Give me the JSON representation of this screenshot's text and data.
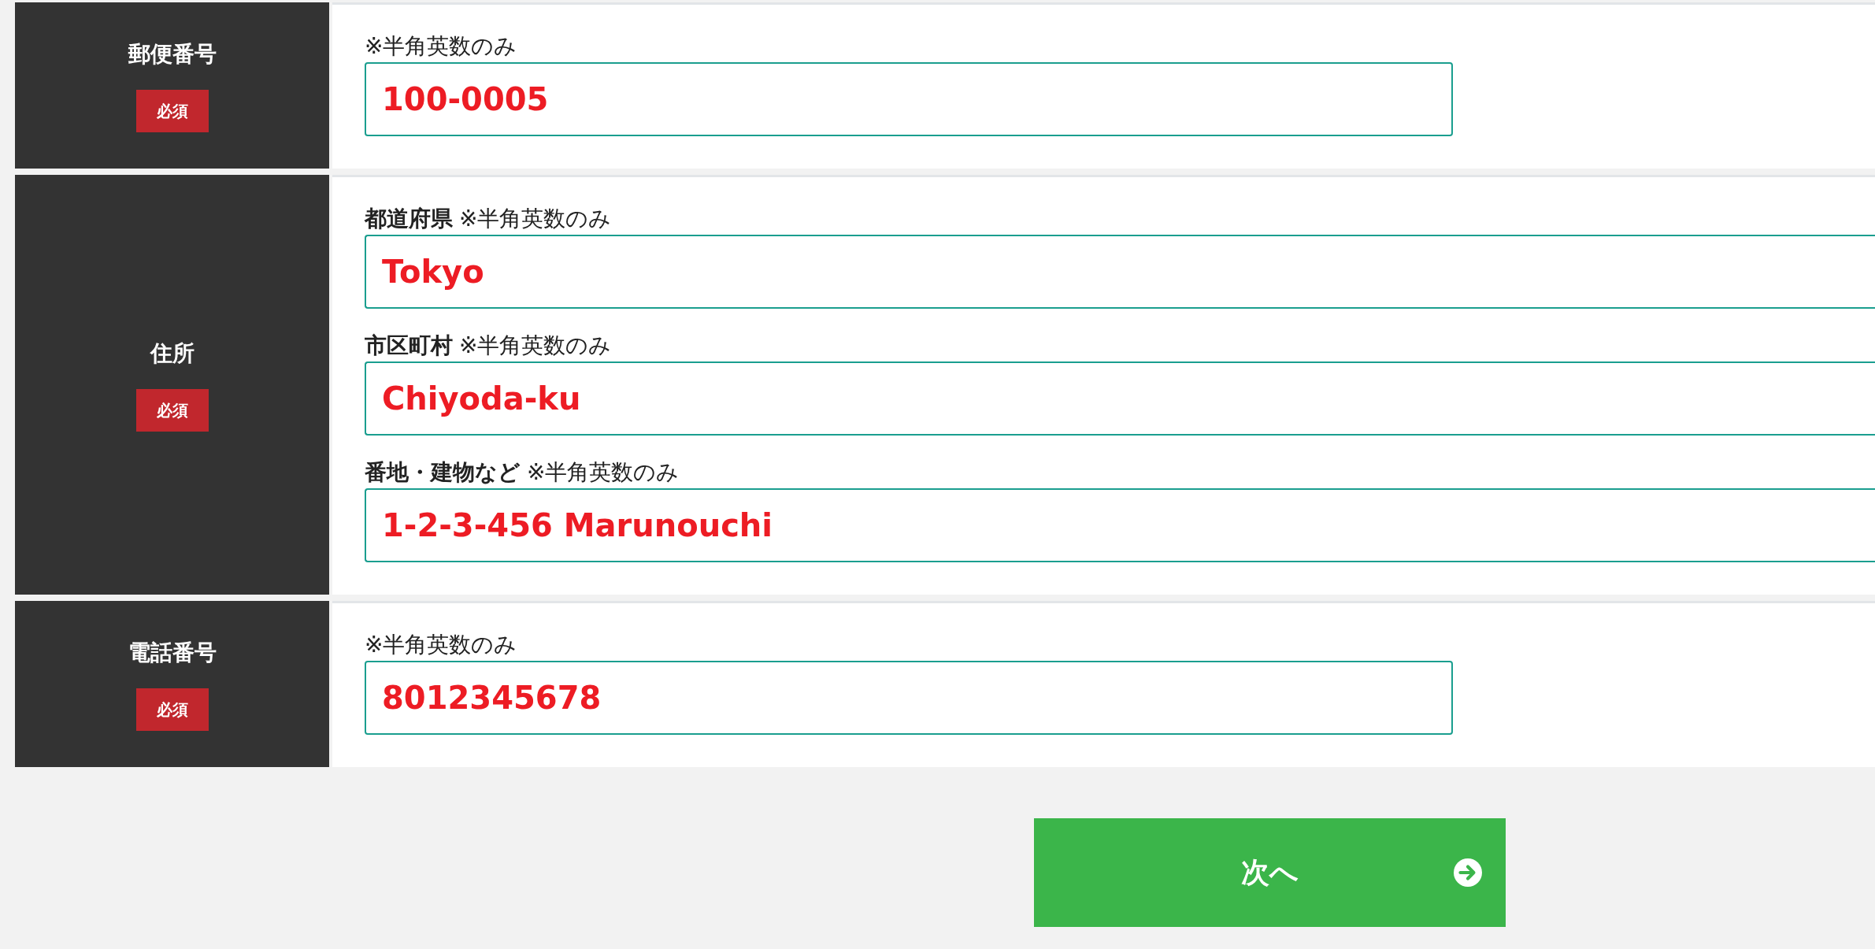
{
  "form": {
    "rows": [
      {
        "label": "郵便番号",
        "required": true,
        "badge": "必須",
        "fields": [
          {
            "note": "※半角英数のみ",
            "value": "100-0005"
          }
        ]
      },
      {
        "label": "住所",
        "required": true,
        "badge": "必須",
        "fields": [
          {
            "label": "都道府県",
            "note": "※半角英数のみ",
            "value": "Tokyo"
          },
          {
            "label": "市区町村",
            "note": "※半角英数のみ",
            "value": "Chiyoda-ku"
          },
          {
            "label": "番地・建物など",
            "note": "※半角英数のみ",
            "value": "1-2-3-456 Marunouchi"
          }
        ]
      },
      {
        "label": "電話番号",
        "required": true,
        "badge": "必須",
        "fields": [
          {
            "note": "※半角英数のみ",
            "value": "8012345678"
          }
        ]
      }
    ]
  },
  "next_button": {
    "label": "次へ"
  }
}
